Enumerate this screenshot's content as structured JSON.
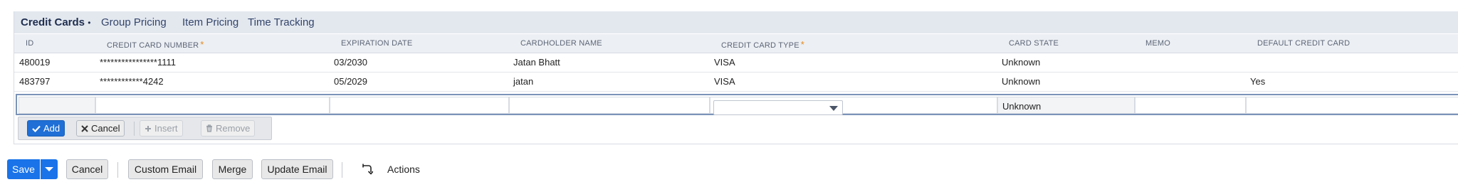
{
  "tabs": [
    {
      "label": "Credit Cards",
      "marker": "•"
    },
    {
      "label": "Group Pricing"
    },
    {
      "label": "Item Pricing"
    },
    {
      "label": "Time Tracking"
    }
  ],
  "columns": [
    {
      "label": "ID",
      "required": false
    },
    {
      "label": "CREDIT CARD NUMBER",
      "required": true
    },
    {
      "label": "EXPIRATION DATE",
      "required": false
    },
    {
      "label": "CARDHOLDER NAME",
      "required": false
    },
    {
      "label": "CREDIT CARD TYPE",
      "required": true
    },
    {
      "label": "CARD STATE",
      "required": false
    },
    {
      "label": "MEMO",
      "required": false
    },
    {
      "label": "DEFAULT CREDIT CARD",
      "required": false
    }
  ],
  "required_marker": "*",
  "rows": [
    {
      "id": "480019",
      "number": "****************1111",
      "expiration": "03/2030",
      "cardholder": "Jatan Bhatt",
      "type": "VISA",
      "state": "Unknown",
      "memo": "",
      "default": ""
    },
    {
      "id": "483797",
      "number": "************4242",
      "expiration": "05/2029",
      "cardholder": "jatan",
      "type": "VISA",
      "state": "Unknown",
      "memo": "",
      "default": "Yes"
    }
  ],
  "edit_row": {
    "id": "",
    "number": "",
    "expiration": "",
    "cardholder": "",
    "type": "",
    "state": "Unknown",
    "memo": "",
    "default": ""
  },
  "line_buttons": {
    "add": "Add",
    "cancel": "Cancel",
    "insert": "Insert",
    "remove": "Remove"
  },
  "footer": {
    "save": "Save",
    "cancel": "Cancel",
    "custom_email": "Custom Email",
    "merge": "Merge",
    "update_email": "Update Email",
    "actions": "Actions"
  },
  "colors": {
    "primary": "#1a73e8",
    "tab_bar": "#e3e8ef",
    "required": "#e58a1f"
  }
}
